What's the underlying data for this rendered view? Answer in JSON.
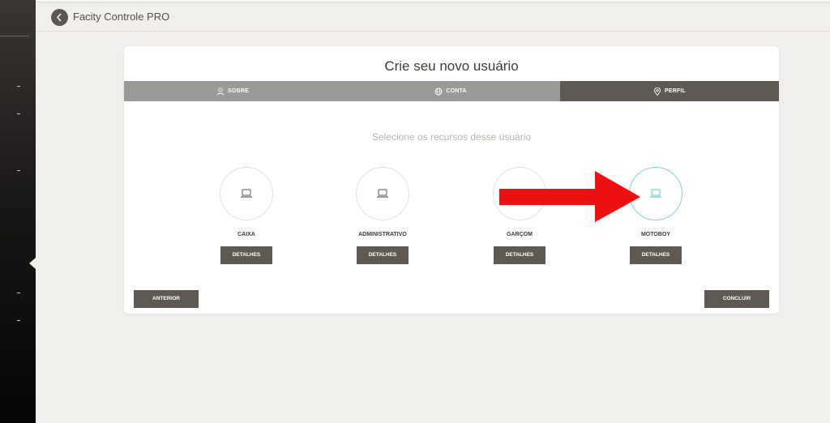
{
  "app": {
    "title": "Facity Controle PRO"
  },
  "card": {
    "title": "Crie seu novo usuário",
    "subtitle": "Selecione os recursos desse usuário"
  },
  "steps": [
    {
      "label": "SOBRE",
      "icon": "user-icon"
    },
    {
      "label": "CONTA",
      "icon": "globe-icon"
    },
    {
      "label": "PERFIL",
      "icon": "location-pin-icon",
      "active": true
    }
  ],
  "roles": [
    {
      "name": "CAIXA",
      "details_label": "DETALHES",
      "icon": "laptop-icon"
    },
    {
      "name": "ADMINISTRATIVO",
      "details_label": "DETALHES",
      "icon": "laptop-icon"
    },
    {
      "name": "GARÇOM",
      "details_label": "DETALHES",
      "icon": "laptop-icon"
    },
    {
      "name": "MOTOBOY",
      "details_label": "DETALHES",
      "icon": "laptop-icon",
      "selected": true
    }
  ],
  "actions": {
    "previous_label": "ANTERIOR",
    "finish_label": "CONCLUIR"
  },
  "colors": {
    "dark": "#5f5954",
    "step_inactive": "#9c9a97",
    "selected": "#7fd3d6",
    "arrow": "#ee1111"
  }
}
